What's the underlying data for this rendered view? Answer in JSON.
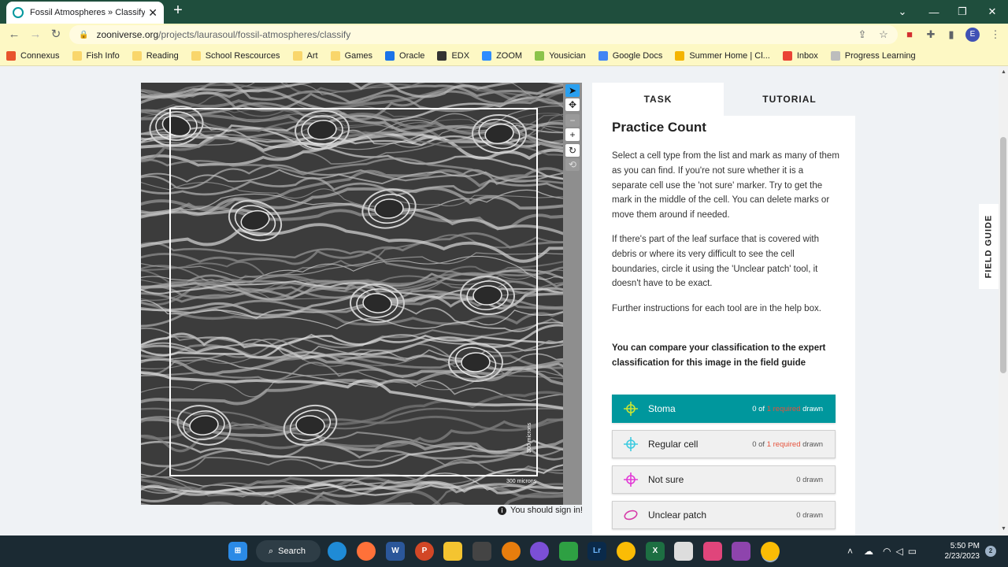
{
  "browser": {
    "tab_title": "Fossil Atmospheres » Classify —",
    "new_tab": "+",
    "address_host": "zooniverse.org",
    "address_path": "/projects/laurasoul/fossil-atmospheres/classify",
    "profile_initial": "E",
    "bookmarks": [
      {
        "label": "Connexus",
        "icon": "connexus-icon",
        "color": "#e8542c"
      },
      {
        "label": "Fish Info",
        "icon": "folder-icon"
      },
      {
        "label": "Reading",
        "icon": "folder-icon"
      },
      {
        "label": "School Rescources",
        "icon": "folder-icon"
      },
      {
        "label": "Art",
        "icon": "folder-icon"
      },
      {
        "label": "Games",
        "icon": "folder-icon"
      },
      {
        "label": "Oracle",
        "icon": "cloud-icon",
        "color": "#1a73e8"
      },
      {
        "label": "EDX",
        "icon": "edx-icon",
        "color": "#333333"
      },
      {
        "label": "ZOOM",
        "icon": "zoom-icon",
        "color": "#2d8cff"
      },
      {
        "label": "Yousician",
        "icon": "yousician-icon",
        "color": "#8bc34a"
      },
      {
        "label": "Google Docs",
        "icon": "docs-icon",
        "color": "#4285f4"
      },
      {
        "label": "Summer Home | Cl...",
        "icon": "summer-home-icon",
        "color": "#f4b400"
      },
      {
        "label": "Inbox",
        "icon": "gmail-icon",
        "color": "#ea4335"
      },
      {
        "label": "Progress Learning",
        "icon": "progress-icon",
        "color": "#bdbdbd"
      }
    ]
  },
  "viewer": {
    "scale_label": "300 microns",
    "tools": [
      "select-icon",
      "move-icon",
      "zoom-out-icon",
      "zoom-in-icon",
      "rotate-icon",
      "reset-icon"
    ],
    "signin_text": "You should sign in!"
  },
  "panel": {
    "tabs": {
      "task": "TASK",
      "tutorial": "TUTORIAL"
    },
    "title": "Practice Count",
    "p1": "Select a cell type from the list and mark as many of them as you can find. If you're not sure whether it is a separate cell use the 'not sure' marker. Try to get the mark in the middle of the cell. You can delete marks or move them around if needed.",
    "p2": "If there's part of the leaf surface that is covered with debris or where its very difficult to see the cell boundaries, circle it using the 'Unclear patch' tool, it doesn't have to be exact.",
    "p3": "Further instructions for each tool are in the help box.",
    "p4": "You can compare your classification to the expert classification for this image in the field guide",
    "choices": [
      {
        "label": "Stoma",
        "count_pre": "0 of ",
        "count_req": "1 required",
        "count_post": " drawn",
        "color": "#c9e634",
        "icon": "crosshair-icon"
      },
      {
        "label": "Regular cell",
        "count_pre": "0 of ",
        "count_req": "1 required",
        "count_post": " drawn",
        "color": "#3ecbe0",
        "icon": "crosshair-icon"
      },
      {
        "label": "Not sure",
        "count_pre": "0 drawn",
        "count_req": "",
        "count_post": "",
        "color": "#e23ad6",
        "icon": "crosshair-icon"
      },
      {
        "label": "Unclear patch",
        "count_pre": "0 drawn",
        "count_req": "",
        "count_post": "",
        "color": "#d63aa8",
        "icon": "ellipse-icon"
      }
    ],
    "field_guide": "FIELD GUIDE"
  },
  "taskbar": {
    "search_label": "Search",
    "time": "5:50 PM",
    "date": "2/23/2023",
    "notifications": "2"
  },
  "colors": {
    "accent": "#00979d",
    "required": "#e5533d",
    "tab_bar": "#1f4e3d",
    "address_bar": "#fdf8c4"
  }
}
